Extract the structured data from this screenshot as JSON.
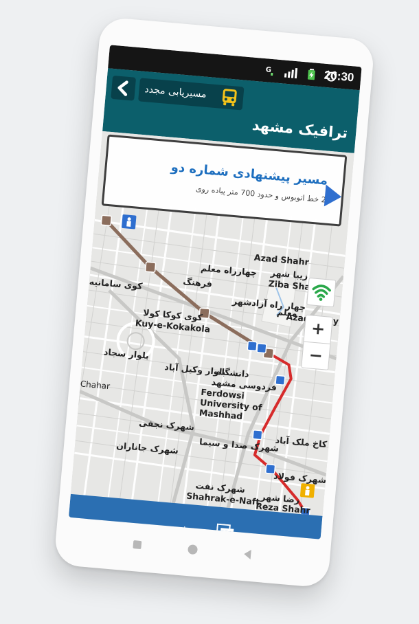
{
  "status_bar": {
    "time": "20:30",
    "icons": [
      "signal-icon",
      "battery-icon",
      "alarm-icon"
    ]
  },
  "app_bar": {
    "title": "ترافیک مشهد",
    "back_icon": "chevron-left-icon",
    "reroute_label": "مسیریابی مجدد",
    "reroute_icon": "bus-icon"
  },
  "route_card": {
    "title": "مسیر پیشنهادی شماره دو",
    "subtitle": "2 خط اتوبوس و حدود 700 متر پیاده روی",
    "next_icon": "play-icon"
  },
  "map": {
    "labels": {
      "azad_shahr": "Azad Shahr",
      "chahar_rah_moallem": "چهارراه معلم",
      "ziba_shahr_fa": "زیبا شهر",
      "ziba_shahr": "Ziba Shahr",
      "farhang": "فرهنگ",
      "chahar_rah_azadshahr": "چهار راه آزادشهر",
      "moallem": "معلم",
      "kuy_samaneh": "کوی سامانیه",
      "kuy_kokakola_fa": "کوی کوکا کولا",
      "kuy_kokakola": "Kuy-e-Kokakola",
      "azadi_exp": "Azadi Expy",
      "daneshgah": "دانشگاه",
      "ferdowsi_fa": "فردوسی مشهد",
      "ferdowsi": "Ferdowsi University of Mashhad",
      "bolvar_vakilabad": "بلوار وکیل آباد",
      "bolvar_sajad": "بلوار سجاد",
      "chahar": "Chahar",
      "shahrak_najafi": "شهرک نجفی",
      "shahrak_sada_sima": "شهرک صدا و سیما",
      "shahrak_javan": "شهرک جاناران",
      "kakh_malekabad": "کاخ ملک آباد",
      "shahrak_naft_fa": "شهرک نفت",
      "shahrak_naft": "Shahrak-e-Naft",
      "reza_shahr_fa": "رضا شهر",
      "reza_shahr": "Reza Shahr",
      "shahrak_foolad": "شهرک فولاد",
      "shahrak": "شهرک"
    },
    "zoom_in": "+",
    "zoom_out": "−"
  },
  "bottom_bar": {
    "label": "توصیف مسیر",
    "icon": "document-icon"
  },
  "nav_bar": {
    "items": [
      "recents-icon",
      "home-icon",
      "back-icon"
    ]
  },
  "colors": {
    "app_bar": "#0c5f6b",
    "route": "#d62b2b",
    "walk": "#8b6d5c",
    "bottom_bar": "#2b6fb2",
    "bus_stop": "#2f6fcf",
    "traffic_green": "#2aa84a"
  }
}
